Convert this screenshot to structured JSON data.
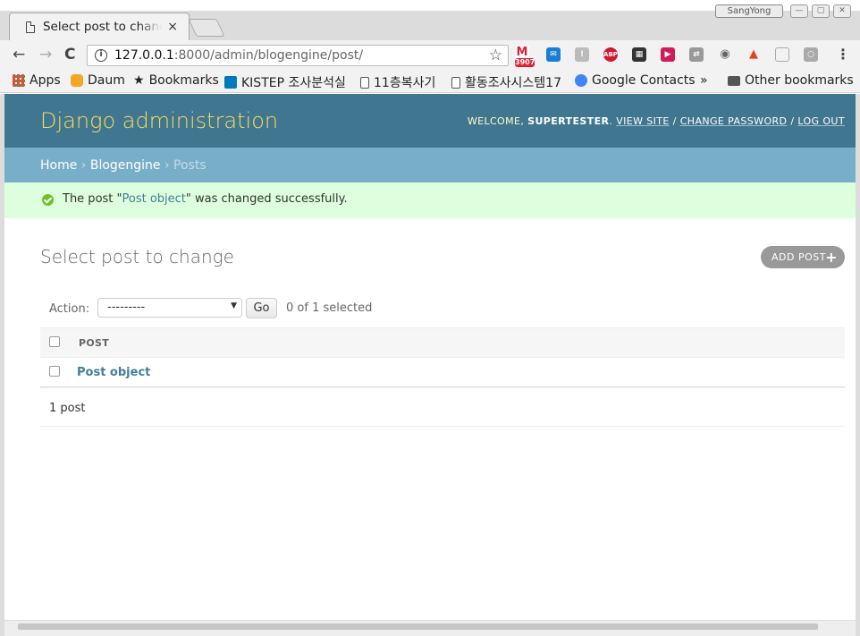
{
  "browser": {
    "tab_title": "Select post to change",
    "tab_close": "×",
    "window_user": "SangYong",
    "url_host": "127.0.0.1",
    "url_path": ":8000/admin/blogengine/post/",
    "nav": {
      "back": "←",
      "forward": "→",
      "reload": "C"
    },
    "info_glyph": "i",
    "star": "☆",
    "menu": "⋮",
    "gmail_badge": "3907",
    "bookmarks": [
      {
        "label": "Apps"
      },
      {
        "label": "Daum"
      },
      {
        "label": "Bookmarks"
      },
      {
        "label": "KISTEP 조사분석실"
      },
      {
        "label": "11층복사기"
      },
      {
        "label": "활동조사시스템17"
      },
      {
        "label": "Google Contacts"
      },
      {
        "label": "»"
      },
      {
        "label": "Other bookmarks"
      }
    ]
  },
  "admin": {
    "branding": "Django administration",
    "user_tools": {
      "welcome": "WELCOME, ",
      "username": "SUPERTESTER",
      "view_site": "VIEW SITE",
      "change_password": "CHANGE PASSWORD",
      "log_out": "LOG OUT",
      "sep": " / "
    },
    "breadcrumbs": {
      "home": "Home",
      "app": "Blogengine",
      "current": "Posts",
      "sep": " › "
    },
    "message": {
      "prefix": "The post \"",
      "link": "Post object",
      "suffix": "\" was changed successfully."
    },
    "title": "Select post to change",
    "add_button": "ADD POST",
    "add_plus": "+",
    "actions": {
      "label": "Action:",
      "selected": "---------",
      "arrow": "▼",
      "go": "Go",
      "counter": "0 of 1 selected"
    },
    "table": {
      "header": "POST",
      "rows": [
        {
          "label": "Post object"
        }
      ]
    },
    "paginator": "1 post"
  }
}
